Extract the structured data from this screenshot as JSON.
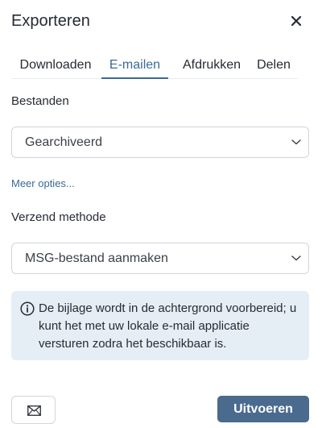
{
  "dialog": {
    "title": "Exporteren",
    "close_icon": "close-icon"
  },
  "tabs": [
    {
      "label": "Downloaden",
      "active": false
    },
    {
      "label": "E-mailen",
      "active": true
    },
    {
      "label": "Afdrukken",
      "active": false
    },
    {
      "label": "Delen",
      "active": false
    }
  ],
  "files": {
    "label": "Bestanden",
    "selected": "Gearchiveerd"
  },
  "more_options": "Meer opties...",
  "send_method": {
    "label": "Verzend methode",
    "selected": "MSG-bestand aanmaken"
  },
  "info": {
    "icon": "info-icon",
    "text": "De bijlage wordt in de achtergrond voorbereid; u kunt het met uw lokale e-mail applicatie versturen zodra het beschikbaar is."
  },
  "footer": {
    "mail_icon": "envelope-icon",
    "execute_label": "Uitvoeren"
  },
  "colors": {
    "accent": "#3a6a97",
    "primary_button": "#4a6a8e",
    "info_background": "#e6eef5",
    "border": "#cfd6de"
  }
}
